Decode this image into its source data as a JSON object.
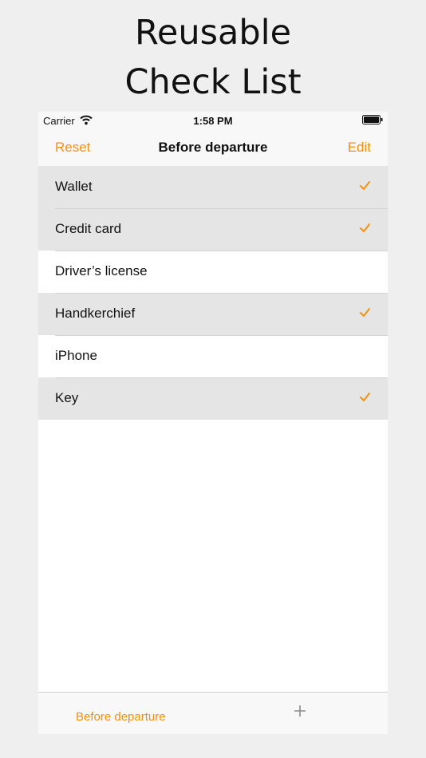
{
  "promo": {
    "line1": "Reusable",
    "line2": "Check List"
  },
  "status_bar": {
    "carrier": "Carrier",
    "time": "1:58 PM"
  },
  "nav": {
    "left_label": "Reset",
    "title": "Before departure",
    "right_label": "Edit"
  },
  "items": [
    {
      "label": "Wallet",
      "checked": true
    },
    {
      "label": "Credit card",
      "checked": true
    },
    {
      "label": "Driver’s license",
      "checked": false
    },
    {
      "label": "Handkerchief",
      "checked": true
    },
    {
      "label": "iPhone",
      "checked": false
    },
    {
      "label": "Key",
      "checked": true
    }
  ],
  "toolbar": {
    "list_label": "Before departure",
    "add_icon": "plus-icon"
  },
  "colors": {
    "accent": "#f0920e",
    "checked_row": "#e5e5e5",
    "background": "#efefef"
  }
}
